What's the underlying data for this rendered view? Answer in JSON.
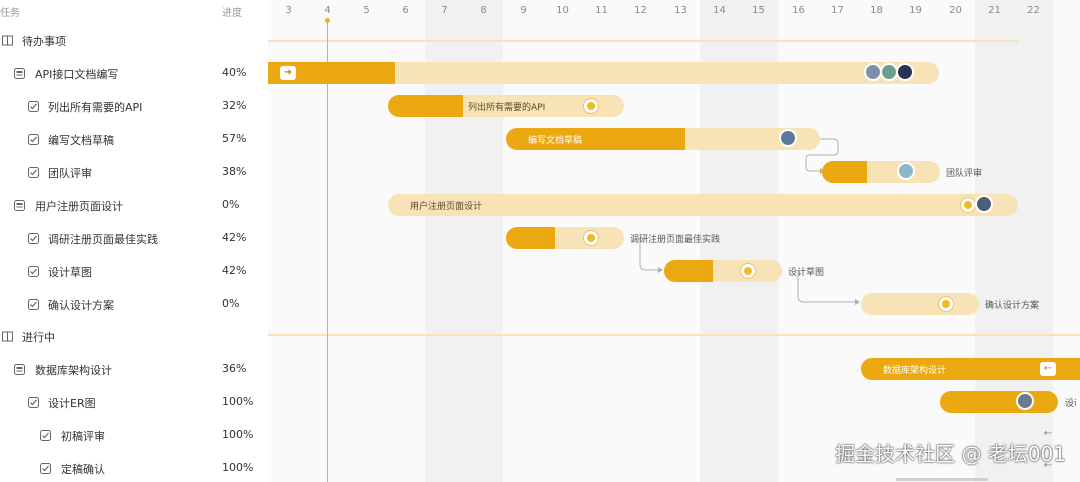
{
  "table": {
    "header_task": "任务",
    "header_progress": "进度",
    "rows": [
      {
        "name": "待办事项",
        "progress": "",
        "icon": "group-icon"
      },
      {
        "name": "API接口文档编写",
        "progress": "40%",
        "icon": "parent-task-icon"
      },
      {
        "name": "列出所有需要的API",
        "progress": "32%",
        "icon": "checkbox-icon"
      },
      {
        "name": "编写文档草稿",
        "progress": "57%",
        "icon": "checkbox-icon"
      },
      {
        "name": "团队评审",
        "progress": "38%",
        "icon": "checkbox-icon"
      },
      {
        "name": "用户注册页面设计",
        "progress": "0%",
        "icon": "parent-task-icon"
      },
      {
        "name": "调研注册页面最佳实践",
        "progress": "42%",
        "icon": "checkbox-icon"
      },
      {
        "name": "设计草图",
        "progress": "42%",
        "icon": "checkbox-icon"
      },
      {
        "name": "确认设计方案",
        "progress": "0%",
        "icon": "checkbox-icon"
      },
      {
        "name": "进行中",
        "progress": "",
        "icon": "group-icon"
      },
      {
        "name": "数据库架构设计",
        "progress": "36%",
        "icon": "parent-task-icon"
      },
      {
        "name": "设计ER图",
        "progress": "100%",
        "icon": "checkbox-icon"
      },
      {
        "name": "初稿评审",
        "progress": "100%",
        "icon": "checkbox-icon"
      },
      {
        "name": "定稿确认",
        "progress": "100%",
        "icon": "checkbox-icon"
      }
    ]
  },
  "timeline": {
    "days": [
      "3",
      "4",
      "5",
      "6",
      "7",
      "8",
      "9",
      "10",
      "11",
      "12",
      "13",
      "14",
      "15",
      "16",
      "17",
      "18",
      "19",
      "20",
      "21",
      "22"
    ],
    "today": "4"
  },
  "bars": {
    "api_doc": "",
    "list_api": "列出所有需要的API",
    "draft": "编写文档草稿",
    "review": "团队评审",
    "signup": "用户注册页面设计",
    "research": "调研注册页面最佳实践",
    "sketch": "设计草图",
    "confirm": "确认设计方案",
    "db": "数据库架构设计",
    "er_cut": "设i"
  },
  "colors": {
    "bar_fill": "#eba810",
    "bar_track": "#f7e3b6",
    "today_line": "#ecb02a"
  },
  "watermark": "掘金技术社区 @ 老坛001"
}
